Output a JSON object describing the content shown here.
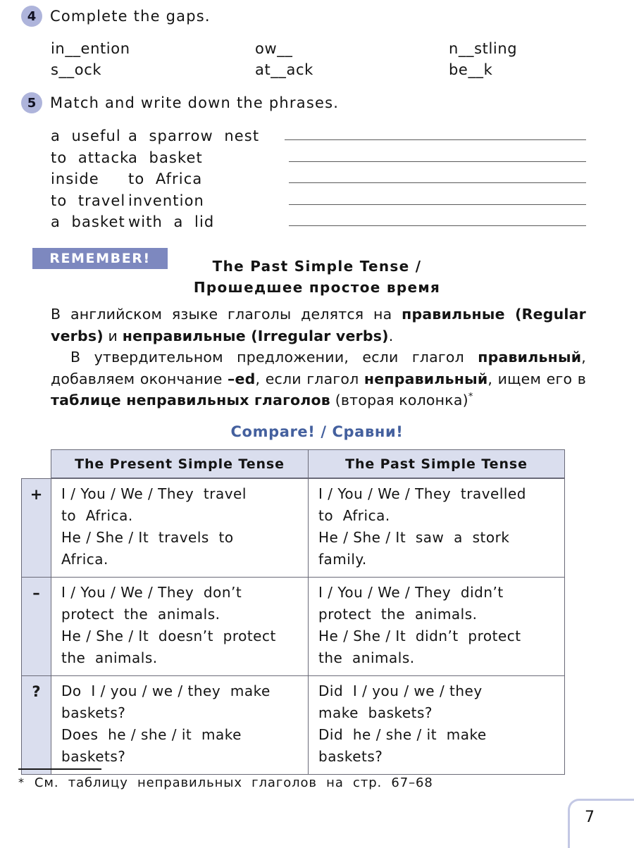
{
  "exercise4": {
    "number": "4",
    "title": "Complete  the  gaps.",
    "rows": [
      {
        "c1": "in__ention",
        "c2": "ow__",
        "c3": "n__stling"
      },
      {
        "c1": "s__ock",
        "c2": "at__ack",
        "c3": "be__k"
      }
    ]
  },
  "exercise5": {
    "number": "5",
    "title": "Match  and  write  down  the  phrases.",
    "pairs": [
      {
        "left": "a  useful",
        "right": "a  sparrow  nest"
      },
      {
        "left": "to  attack",
        "right": "a  basket"
      },
      {
        "left": "inside",
        "right": "to  Africa"
      },
      {
        "left": "to  travel",
        "right": "invention"
      },
      {
        "left": "a  basket",
        "right": "with  a  lid"
      }
    ]
  },
  "remember": {
    "banner_label": "REMEMBER!",
    "title_en": "The  Past  Simple  Tense /",
    "title_ru": "Прошедшее  простое  время",
    "paragraph1_html": "В  английском  языке  глаголы  делятся  на  <b>правильные (Regular verbs)</b>  и  <b>неправильные (Irregular verbs)</b>.",
    "paragraph2_html": "В  утвердительном  предложении,  если  глагол  <b>правильный</b>,  добавляем  окончание  <b>–ed</b>,  если  глагол  <b>неправильный</b>,  ищем  его  в  <b>таблице  неправильных  глаголов</b>  (вторая  колонка)<sup>*</sup>"
  },
  "compare": {
    "heading": "Compare! / Сравни!",
    "headers": [
      "The  Present  Simple  Tense",
      "The  Past  Simple  Tense"
    ],
    "rows": [
      {
        "sign": "+",
        "present": [
          "I / You / We / They  travel",
          "to  Africa.",
          "He / She / It  travels  to",
          "Africa."
        ],
        "past": [
          "I / You / We / They  travelled",
          "to  Africa.",
          "He / She / It  saw  a  stork",
          "family."
        ]
      },
      {
        "sign": "–",
        "present": [
          "I / You / We / They  don’t",
          "protect  the  animals.",
          "He / She / It  doesn’t  protect",
          "the  animals."
        ],
        "past": [
          "I / You / We / They  didn’t",
          "protect  the  animals.",
          "He / She / It  didn’t  protect",
          "the  animals."
        ]
      },
      {
        "sign": "?",
        "present": [
          "Do  I / you / we / they  make",
          "baskets?",
          "Does  he / she / it  make",
          "baskets?"
        ],
        "past": [
          "Did  I / you / we / they",
          "make  baskets?",
          "Did  he / she / it  make",
          "baskets?"
        ]
      }
    ]
  },
  "footnote": {
    "marker": "*",
    "text": "См.  таблицу  неправильных  глаголов  на  стр.  67–68"
  },
  "page_number": "7",
  "colors": {
    "badge": "#aeb4db",
    "banner": "#7d88bf",
    "table_header_bg": "#dadeee",
    "table_border": "#6a6a78",
    "compare_heading": "#44609e",
    "corner": "#c3c8e4"
  }
}
